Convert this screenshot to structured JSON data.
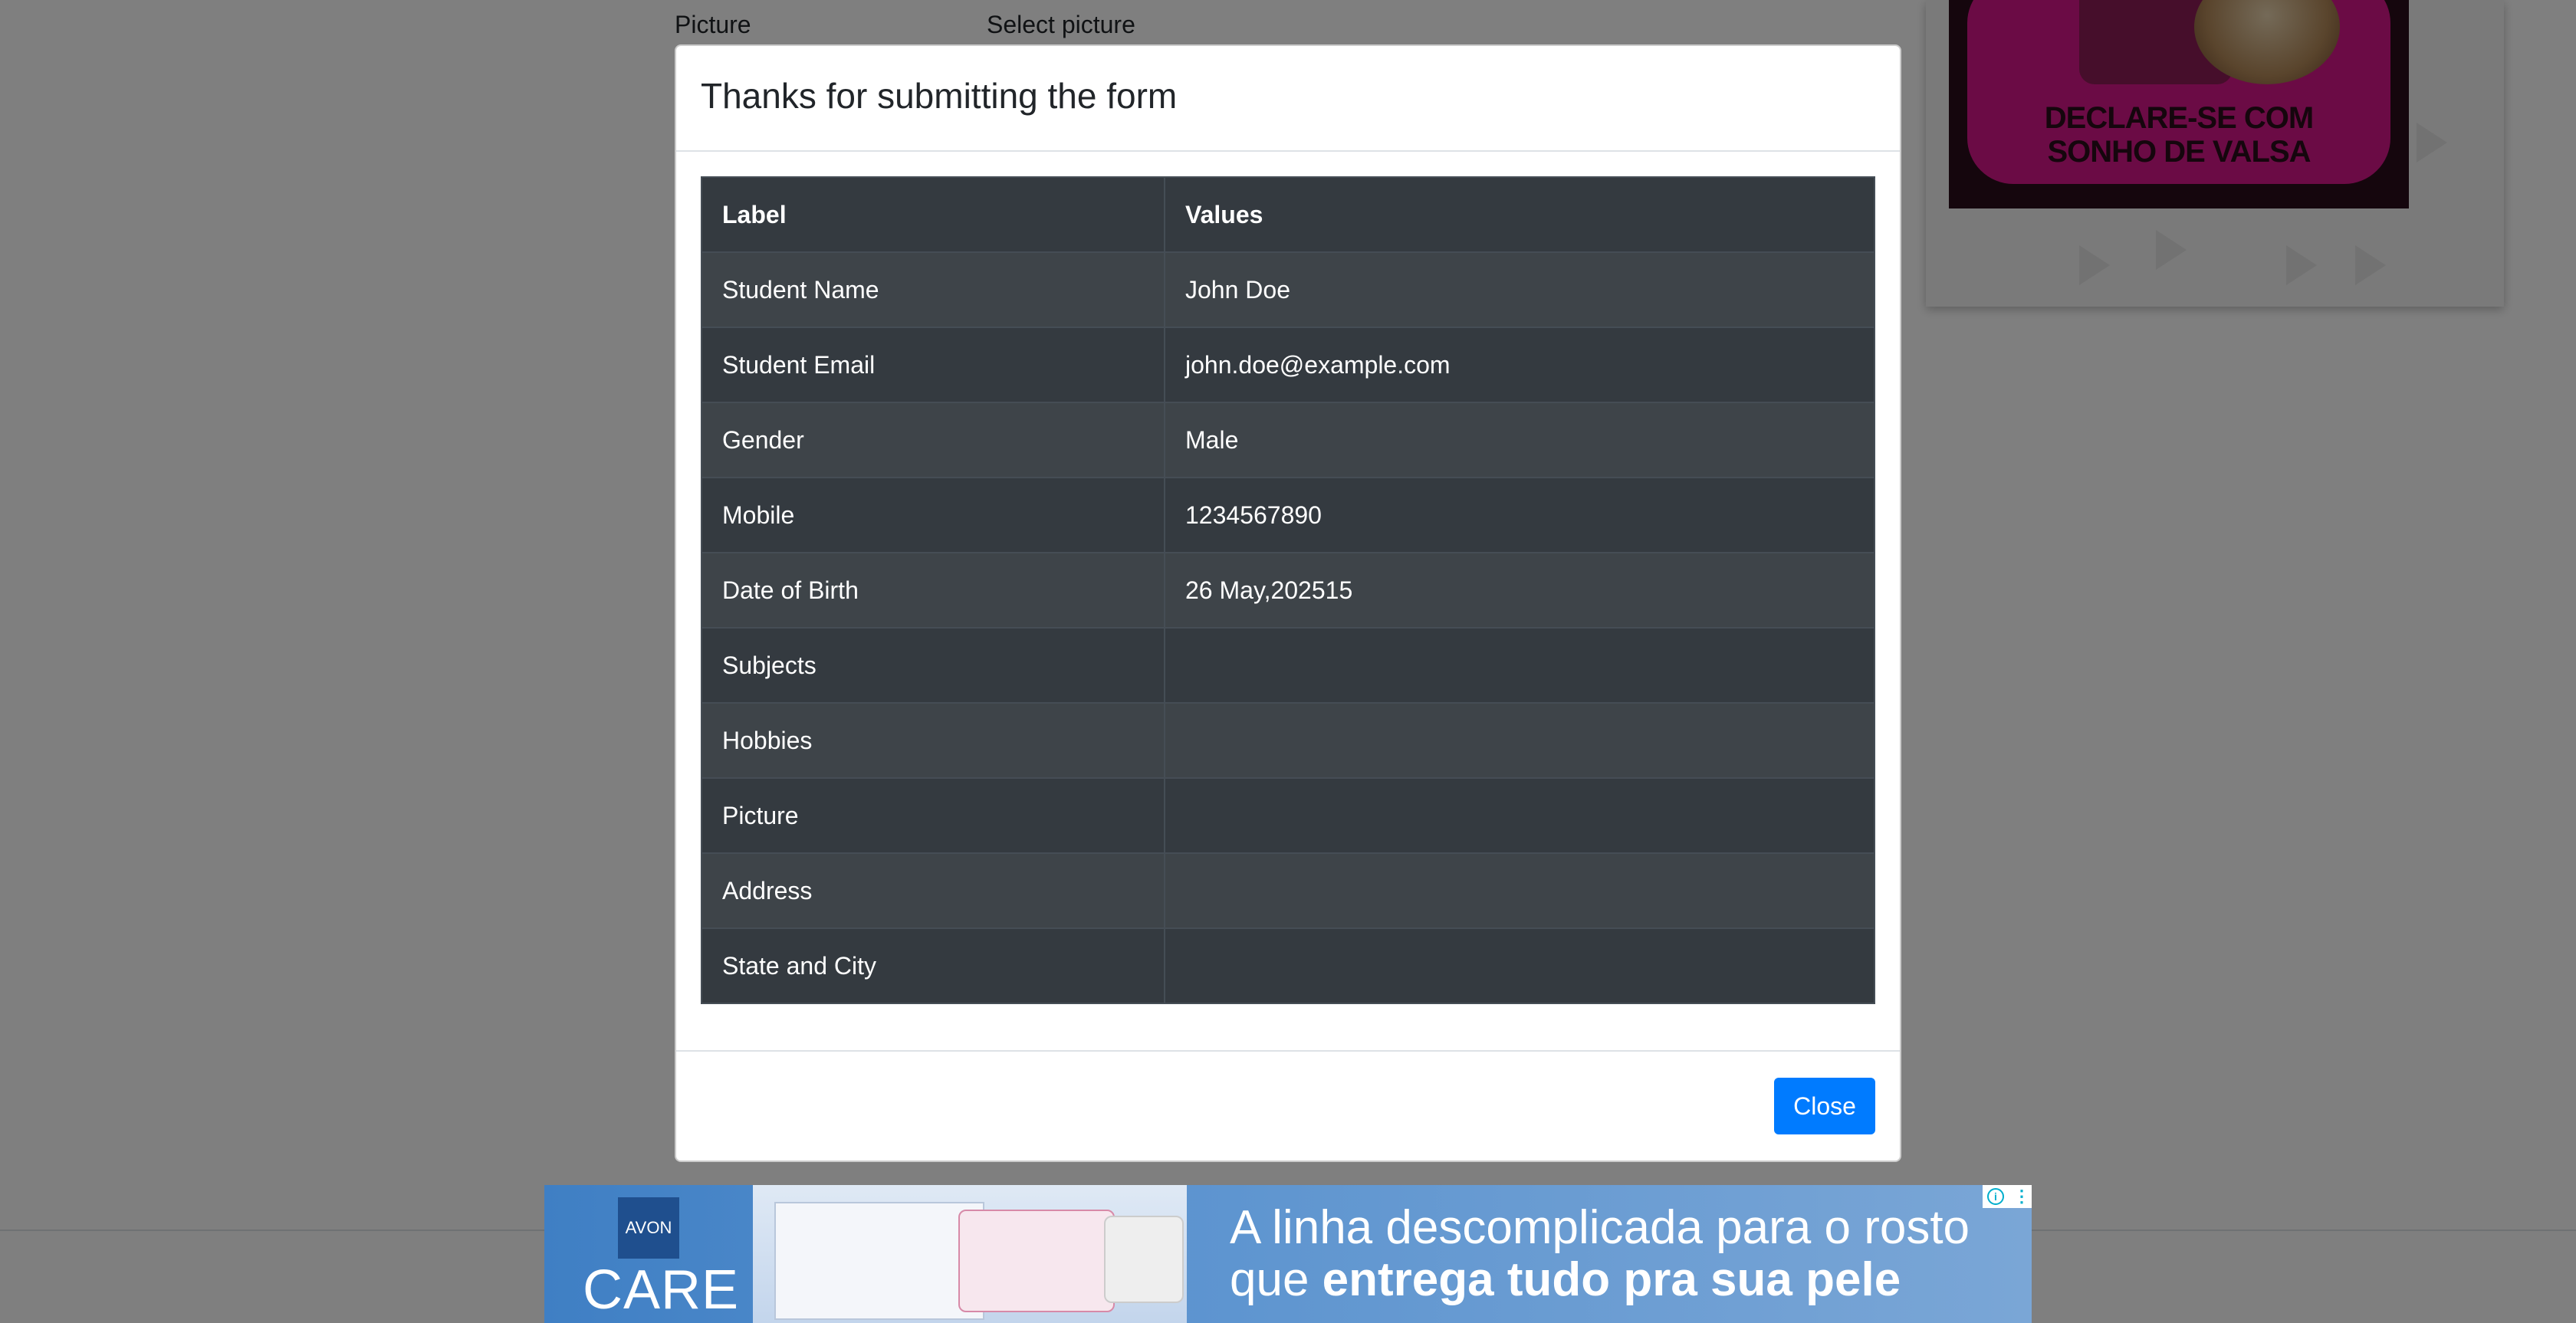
{
  "background_page": {
    "picture_label": "Picture",
    "select_picture_label": "Select picture",
    "ad": {
      "text_line1": "DECLARE-SE COM",
      "text_line2": "SONHO DE VALSA"
    }
  },
  "modal": {
    "title": "Thanks for submitting the form",
    "table": {
      "headers": [
        "Label",
        "Values"
      ],
      "rows": [
        {
          "label": "Student Name",
          "value": "John Doe"
        },
        {
          "label": "Student Email",
          "value": "john.doe@example.com"
        },
        {
          "label": "Gender",
          "value": "Male"
        },
        {
          "label": "Mobile",
          "value": "1234567890"
        },
        {
          "label": "Date of Birth",
          "value": "26 May,202515"
        },
        {
          "label": "Subjects",
          "value": ""
        },
        {
          "label": "Hobbies",
          "value": ""
        },
        {
          "label": "Picture",
          "value": ""
        },
        {
          "label": "Address",
          "value": ""
        },
        {
          "label": "State and City",
          "value": ""
        }
      ]
    },
    "close_label": "Close"
  },
  "ad_banner": {
    "brand": "AVON",
    "care": "CARE",
    "line1": "A linha descomplicada para o rosto",
    "line2_prefix": "que ",
    "line2_bold": "entrega tudo pra sua pele",
    "info_icon": "i",
    "menu_icon": "⋮"
  },
  "colors": {
    "primary": "#007bff",
    "table_dark": "#343a40",
    "backdrop": "rgba(0,0,0,0.5)"
  }
}
